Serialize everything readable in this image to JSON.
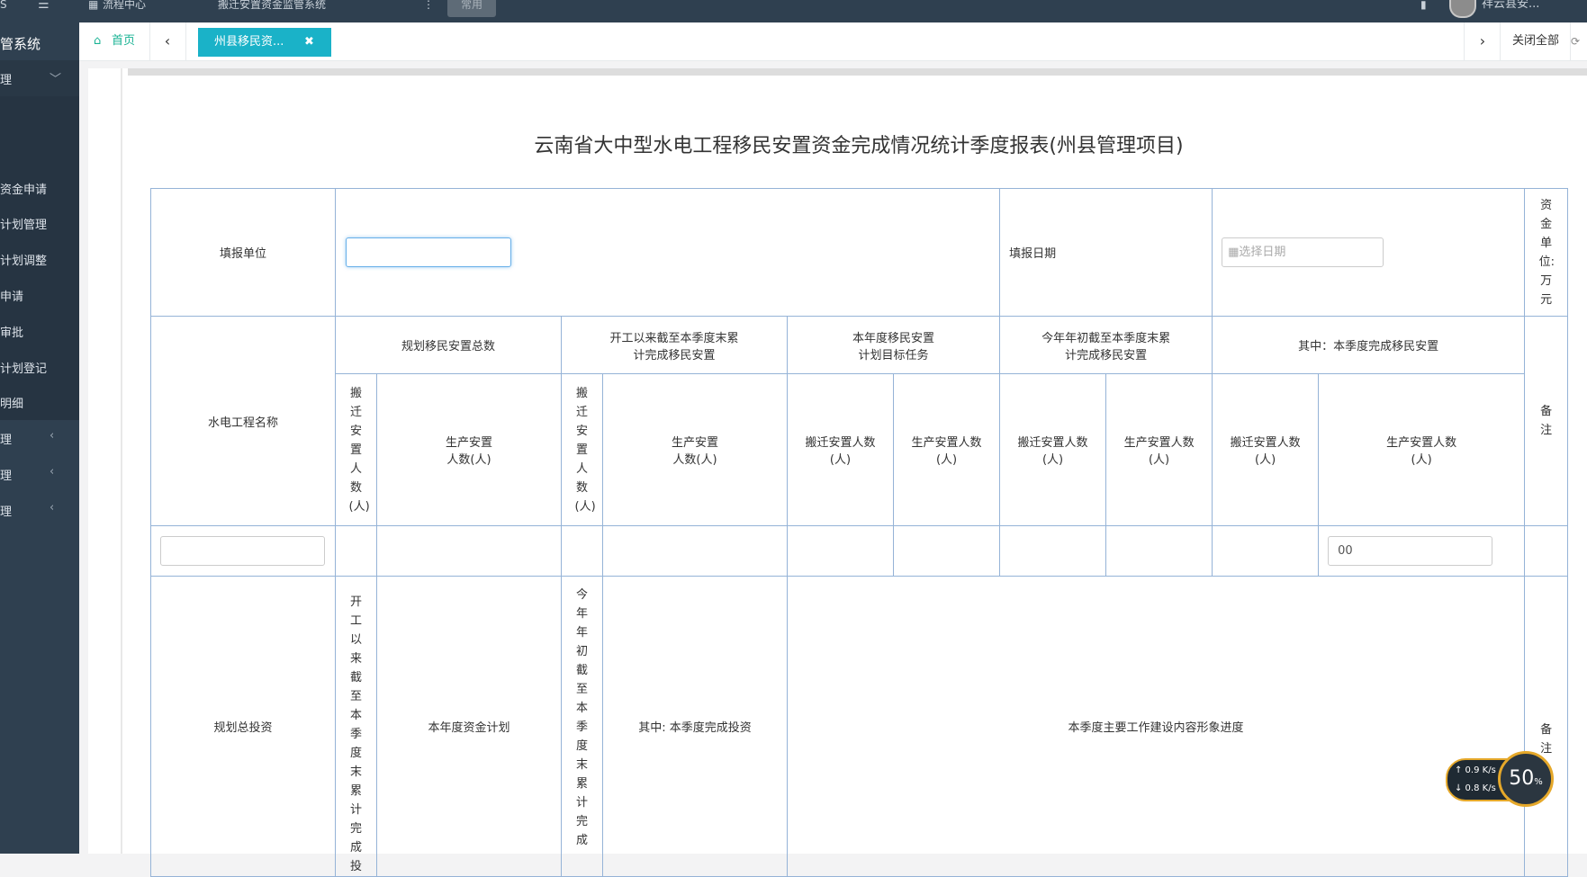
{
  "topbar": {
    "nav_label": "流程中心",
    "system_title": "搬迁安置资金监管系统",
    "common_label": "常用",
    "user_name": "祥云县安..."
  },
  "sidebar": {
    "brand": "管系统",
    "groups": [
      {
        "label": "理",
        "icon": "chevron-down-icon"
      }
    ],
    "items": [
      {
        "label": "资金申请"
      },
      {
        "label": "计划管理"
      },
      {
        "label": "计划调整"
      },
      {
        "label": "申请"
      },
      {
        "label": "审批"
      },
      {
        "label": "计划登记"
      },
      {
        "label": "明细"
      }
    ],
    "collapsed_groups": [
      {
        "label": "理",
        "icon": "chevron-left-icon"
      },
      {
        "label": "理",
        "icon": "chevron-left-icon"
      },
      {
        "label": "理",
        "icon": "chevron-left-icon"
      }
    ]
  },
  "tabs": {
    "home_label": "首页",
    "active_tab": "州县移民资...",
    "close_icon": "✖",
    "close_all": "关闭全部",
    "accent": "#1ab2c8"
  },
  "report": {
    "title": "云南省大中型水电工程移民安置资金完成情况统计季度报表(州县管理项目)",
    "unit_label": "填报单位",
    "unit_value": "",
    "date_label": "填报日期",
    "date_placeholder": "选择日期",
    "currency_note": "资金单位:万元",
    "project_name_label": "水电工程名称",
    "groups": [
      "规划移民安置总数",
      "开工以来截至本季度末累计完成移民安置",
      "本年度移民安置计划目标任务",
      "今年年初截至本季度末累计完成移民安置",
      "其中：本季度完成移民安置"
    ],
    "relocation_vertical": "搬迁安置人数(人)",
    "production_label": "生产安置人数(人)",
    "relocation_label": "搬迁安置人数(人)",
    "remark_label": "备注",
    "row_input_value": "00",
    "invest_label": "规划总投资",
    "invest_cum_vertical": "开工以来截至本季度末累计完成投",
    "annual_plan_label": "本年度资金计划",
    "year_cum_vertical": "今年年初截至本季度末累计完成",
    "quarter_invest_label": "其中: 本季度完成投资",
    "progress_label": "本季度主要工作建设内容形象进度",
    "remark_label_2": "备注"
  },
  "speed_widget": {
    "up": "↑ 0.9 K/s",
    "down": "↓ 0.8 K/s",
    "percent": "50",
    "percent_unit": "%"
  }
}
